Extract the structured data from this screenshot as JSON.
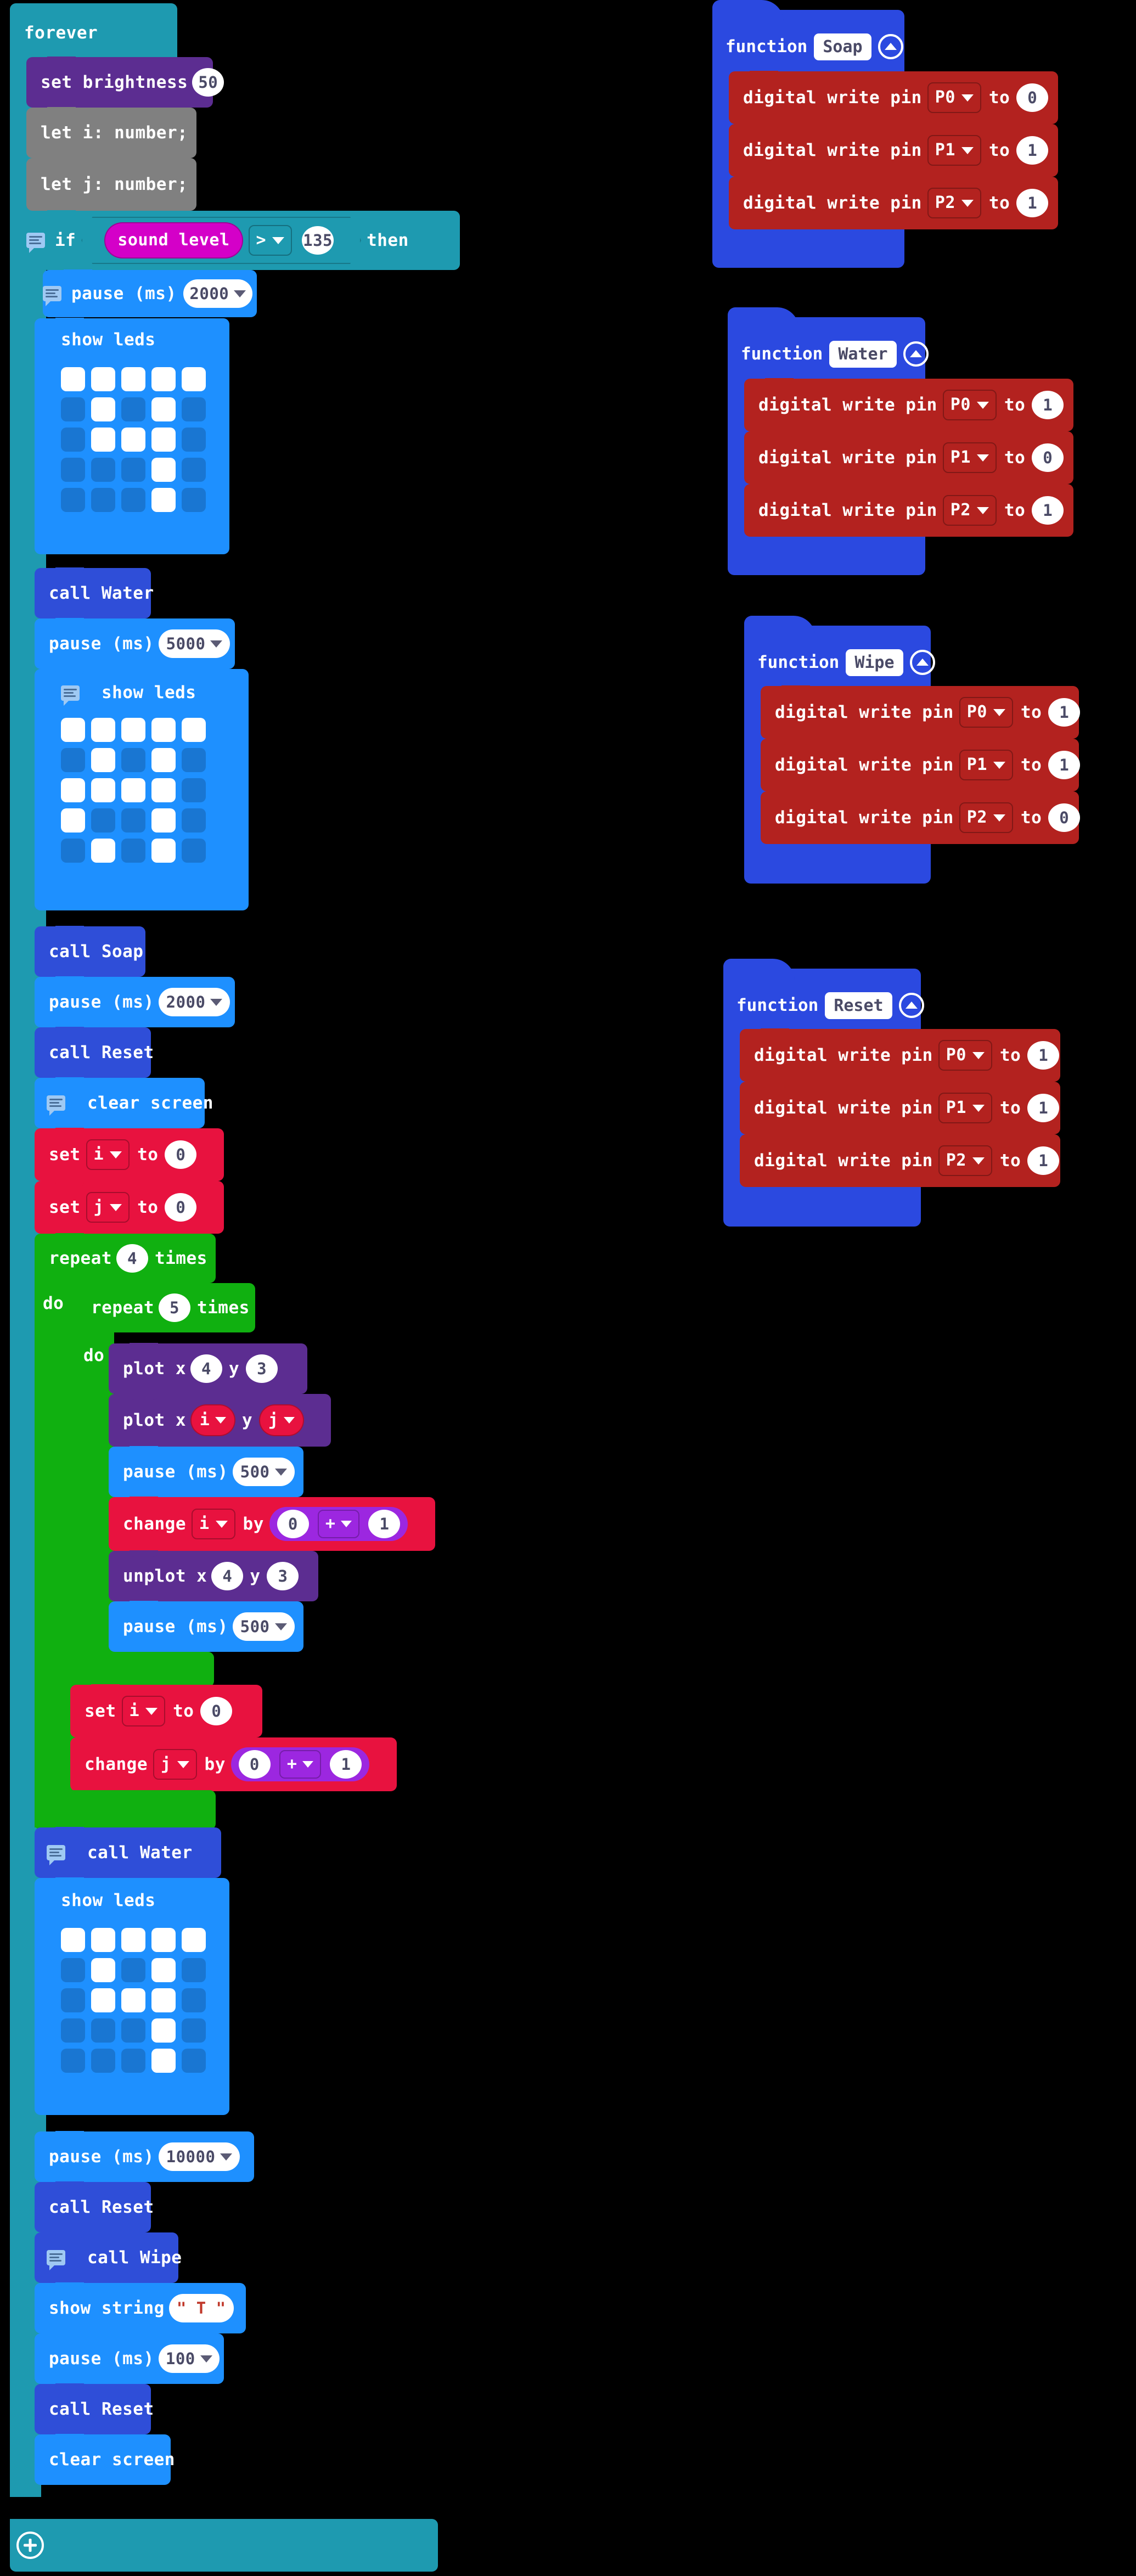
{
  "editor": {
    "name": "MakeCode micro:bit block editor",
    "background": "#000000"
  },
  "colors": {
    "control_teal": "#1e9ab0",
    "basic_blue": "#1e90ff",
    "led_purple": "#5c2d91",
    "variables_red": "#e8123f",
    "math_purple": "#9c27e0",
    "functions_blue": "#2f4ed8",
    "pins_red": "#b3221f",
    "loops_green": "#10b010",
    "input_magenta": "#d400c8",
    "declaration_grey": "#808080",
    "led_on": "#ffffff",
    "led_off": "#1976d2"
  },
  "main_stack": {
    "forever_label": "forever",
    "set_brightness": {
      "label": "set brightness",
      "value": "50"
    },
    "declarations": [
      {
        "text": "let i: number;"
      },
      {
        "text": "let j: number;"
      }
    ],
    "if_block": {
      "if_label": "if",
      "condition_left": "sound level",
      "operator": ">",
      "condition_right": "135",
      "then_label": "then"
    },
    "pause_1": {
      "label": "pause (ms)",
      "value": "2000"
    },
    "show_leds_1": {
      "label": "show leds",
      "rows": [
        [
          1,
          1,
          1,
          1,
          1
        ],
        [
          0,
          1,
          0,
          1,
          0
        ],
        [
          0,
          1,
          1,
          1,
          0
        ],
        [
          0,
          0,
          0,
          1,
          0
        ],
        [
          0,
          0,
          0,
          1,
          0
        ]
      ]
    },
    "call_water_1": "call Water",
    "pause_2": {
      "label": "pause (ms)",
      "value": "5000"
    },
    "show_leds_2": {
      "label": "show leds",
      "rows": [
        [
          1,
          1,
          1,
          1,
          1
        ],
        [
          0,
          1,
          0,
          1,
          0
        ],
        [
          1,
          1,
          1,
          1,
          0
        ],
        [
          1,
          0,
          0,
          1,
          0
        ],
        [
          0,
          1,
          0,
          1,
          0
        ]
      ]
    },
    "call_soap": "call Soap",
    "pause_3": {
      "label": "pause (ms)",
      "value": "2000"
    },
    "call_reset_1": "call Reset",
    "clear_screen_1": "clear screen",
    "set_i": {
      "label": "set",
      "variable": "i",
      "to_label": "to",
      "value": "0"
    },
    "set_j": {
      "label": "set",
      "variable": "j",
      "to_label": "to",
      "value": "0"
    },
    "repeat_outer": {
      "label": "repeat",
      "count": "4",
      "times_label": "times",
      "do_label": "do"
    },
    "repeat_inner": {
      "label": "repeat",
      "count": "5",
      "times_label": "times",
      "do_label": "do"
    },
    "plot_fixed": {
      "label": "plot x",
      "x": "4",
      "y_label": "y",
      "y": "3"
    },
    "plot_var": {
      "label": "plot x",
      "x": "i",
      "y_label": "y",
      "y": "j"
    },
    "pause_4": {
      "label": "pause (ms)",
      "value": "500"
    },
    "change_i": {
      "label": "change",
      "variable": "i",
      "by_label": "by",
      "operand_a": "0",
      "operator": "+",
      "operand_b": "1"
    },
    "unplot": {
      "label": "unplot x",
      "x": "4",
      "y_label": "y",
      "y": "3"
    },
    "pause_5": {
      "label": "pause (ms)",
      "value": "500"
    },
    "set_i_reset": {
      "label": "set",
      "variable": "i",
      "to_label": "to",
      "value": "0"
    },
    "change_j": {
      "label": "change",
      "variable": "j",
      "by_label": "by",
      "operand_a": "0",
      "operator": "+",
      "operand_b": "1"
    },
    "call_water_2": "call Water",
    "show_leds_3": {
      "label": "show leds",
      "rows": [
        [
          1,
          1,
          1,
          1,
          1
        ],
        [
          0,
          1,
          0,
          1,
          0
        ],
        [
          0,
          1,
          1,
          1,
          0
        ],
        [
          0,
          0,
          0,
          1,
          0
        ],
        [
          0,
          0,
          0,
          1,
          0
        ]
      ]
    },
    "pause_6": {
      "label": "pause (ms)",
      "value": "10000"
    },
    "call_reset_2": "call Reset",
    "call_wipe": "call Wipe",
    "show_string": {
      "label": "show string",
      "value": "\" T \""
    },
    "pause_7": {
      "label": "pause (ms)",
      "value": "100"
    },
    "call_reset_3": "call Reset",
    "clear_screen_2": "clear screen"
  },
  "functions": [
    {
      "keyword": "function",
      "name": "Soap",
      "statements": [
        {
          "label": "digital write pin",
          "pin": "P0",
          "to_label": "to",
          "value": "0"
        },
        {
          "label": "digital write pin",
          "pin": "P1",
          "to_label": "to",
          "value": "1"
        },
        {
          "label": "digital write pin",
          "pin": "P2",
          "to_label": "to",
          "value": "1"
        }
      ]
    },
    {
      "keyword": "function",
      "name": "Water",
      "statements": [
        {
          "label": "digital write pin",
          "pin": "P0",
          "to_label": "to",
          "value": "1"
        },
        {
          "label": "digital write pin",
          "pin": "P1",
          "to_label": "to",
          "value": "0"
        },
        {
          "label": "digital write pin",
          "pin": "P2",
          "to_label": "to",
          "value": "1"
        }
      ]
    },
    {
      "keyword": "function",
      "name": "Wipe",
      "statements": [
        {
          "label": "digital write pin",
          "pin": "P0",
          "to_label": "to",
          "value": "1"
        },
        {
          "label": "digital write pin",
          "pin": "P1",
          "to_label": "to",
          "value": "1"
        },
        {
          "label": "digital write pin",
          "pin": "P2",
          "to_label": "to",
          "value": "0"
        }
      ]
    },
    {
      "keyword": "function",
      "name": "Reset",
      "statements": [
        {
          "label": "digital write pin",
          "pin": "P0",
          "to_label": "to",
          "value": "1"
        },
        {
          "label": "digital write pin",
          "pin": "P1",
          "to_label": "to",
          "value": "1"
        },
        {
          "label": "digital write pin",
          "pin": "P2",
          "to_label": "to",
          "value": "1"
        }
      ]
    }
  ]
}
